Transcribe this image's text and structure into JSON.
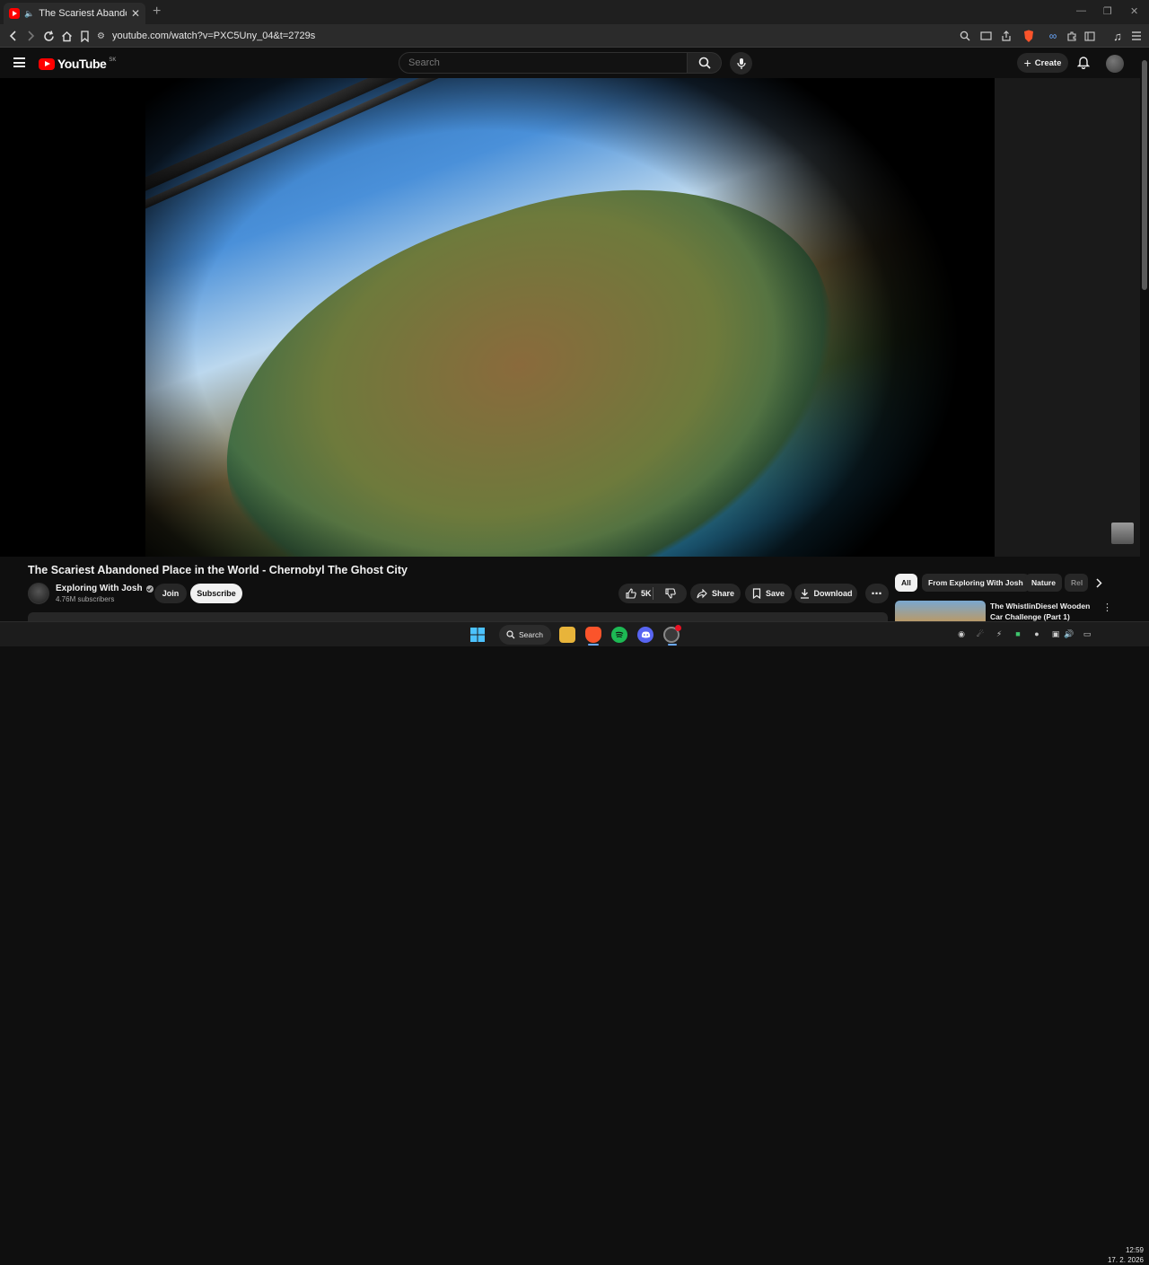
{
  "browser": {
    "tab_title": "The Scariest Abandoned Place",
    "url": "youtube.com/watch?v=PXC5Uny_04&t=2729s"
  },
  "youtube": {
    "logo_text": "YouTube",
    "country_code": "SK",
    "search_placeholder": "Search",
    "create_label": "Create"
  },
  "video": {
    "title": "The Scariest Abandoned Place in the World - Chernobyl The Ghost City",
    "channel_name": "Exploring With Josh",
    "subscribers": "4.76M subscribers",
    "join_label": "Join",
    "subscribe_label": "Subscribe",
    "likes": "5K",
    "share_label": "Share",
    "save_label": "Save",
    "download_label": "Download"
  },
  "chips": {
    "all": "All",
    "from_channel": "From Exploring With Josh",
    "nature": "Nature",
    "related": "Rel"
  },
  "recommendation": {
    "title": "The WhistlinDiesel Wooden Car Challenge (Part 1)"
  },
  "taskbar": {
    "search_label": "Search",
    "time": "12:59",
    "date": "17. 2. 2026"
  },
  "icons": {
    "back": "back-arrow-icon",
    "forward": "forward-arrow-icon",
    "reload": "reload-icon",
    "home": "home-icon",
    "bookmark": "bookmark-icon",
    "site_info": "site-settings-icon",
    "zoom": "zoom-icon",
    "cast": "cast-icon",
    "share": "share-icon",
    "brave_shield": "brave-shield-icon",
    "extensions": "extensions-icon",
    "media": "media-control-icon",
    "menu": "menu-icon"
  },
  "colors": {
    "brand_red": "#ff0000",
    "background": "#0f0f0f",
    "pill": "#272727"
  }
}
